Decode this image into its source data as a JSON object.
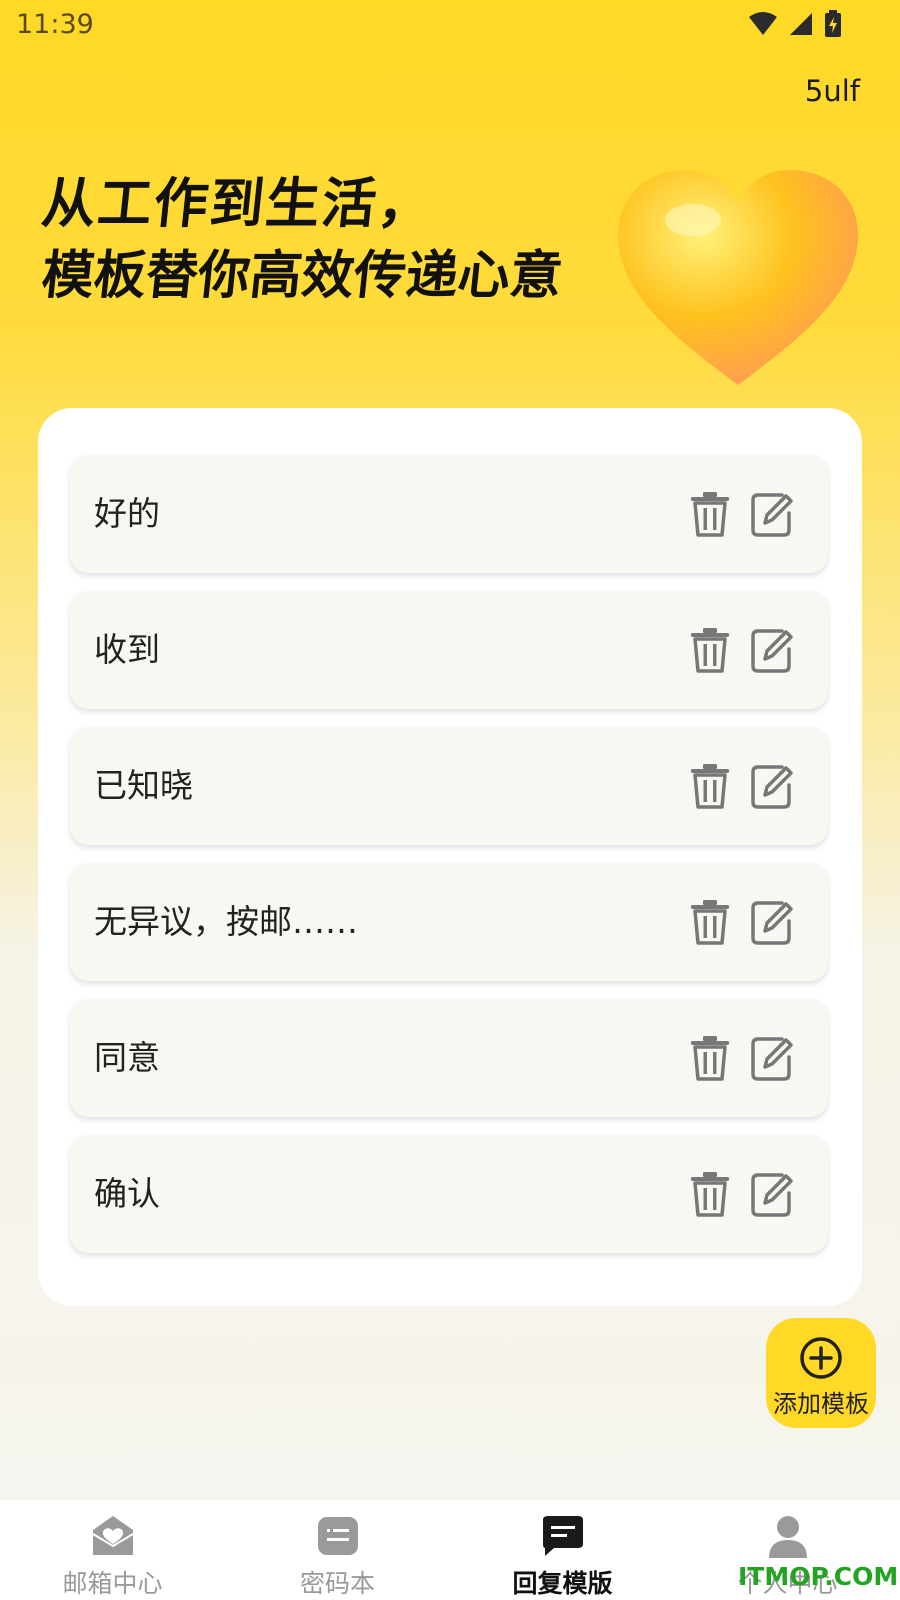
{
  "status_bar": {
    "time": "11:39"
  },
  "header": {
    "user_name": "5ulf"
  },
  "hero": {
    "line1": "从工作到生活，",
    "line2": "模板替你高效传递心意"
  },
  "templates": [
    {
      "text": "好的"
    },
    {
      "text": "收到"
    },
    {
      "text": "已知晓"
    },
    {
      "text": "无异议，按邮……"
    },
    {
      "text": "同意"
    },
    {
      "text": "确认"
    }
  ],
  "add_button": {
    "label": "添加模板"
  },
  "nav": {
    "items": [
      {
        "label": "邮箱中心",
        "icon": "mail-heart-icon"
      },
      {
        "label": "密码本",
        "icon": "keyboard-icon"
      },
      {
        "label": "回复模版",
        "icon": "message-icon"
      },
      {
        "label": "个人中心",
        "icon": "person-icon"
      }
    ],
    "active_index": 2
  },
  "watermark": {
    "text": "ITMOP.COM"
  },
  "colors": {
    "accent": "#FFD926",
    "active_text": "#111111",
    "inactive_text": "#9a9a9a"
  }
}
